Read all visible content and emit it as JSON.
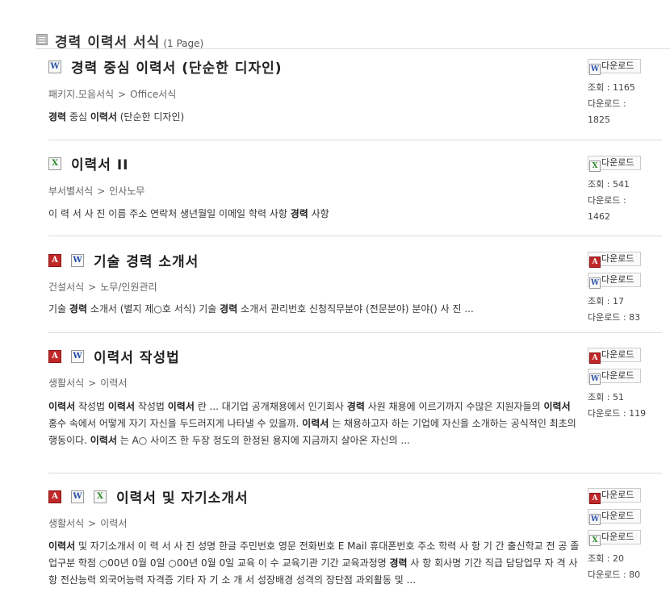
{
  "header": {
    "title": "경력 이력서 서식",
    "pages": "(1 Page)"
  },
  "download_label": "다운로드",
  "items": [
    {
      "title": "경력 중심 이력서 (단순한 디자인)",
      "cat1": "패키지.모음서식",
      "cat2": "Office서식",
      "desc_parts": [
        [
          "경력",
          true
        ],
        [
          " 중심 ",
          false
        ],
        [
          "이력서",
          true
        ],
        [
          " (단순한 디자인)",
          false
        ]
      ],
      "views_label": "조회 : 1165",
      "downloads_label": "다운로드 :",
      "downloads_value": "1825"
    },
    {
      "title": "이력서 II",
      "cat1": "부서별서식",
      "cat2": "인사노무",
      "desc_parts": [
        [
          "이 력 서 사 진 이름 주소 연락처 생년월일 이메일 학력 사항 ",
          false
        ],
        [
          "경력",
          true
        ],
        [
          " 사항",
          false
        ]
      ],
      "views_label": "조회 : 541",
      "downloads_label": "다운로드 :",
      "downloads_value": "1462"
    },
    {
      "title": "기술 경력 소개서",
      "cat1": "건설서식",
      "cat2": "노무/인원관리",
      "desc_parts": [
        [
          "기술 ",
          false
        ],
        [
          "경력",
          true
        ],
        [
          " 소개서 (별지 제○호 서식) 기술 ",
          false
        ],
        [
          "경력",
          true
        ],
        [
          " 소개서 관리번호 신청직무분야 (전문분야) 분야() 사 진 ...",
          false
        ]
      ],
      "views_label": "조회 : 17",
      "downloads_label": "다운로드 : 83"
    },
    {
      "title": "이력서 작성법",
      "cat1": "생활서식",
      "cat2": "이력서",
      "desc_parts": [
        [
          "이력서",
          true
        ],
        [
          " 작성법 ",
          false
        ],
        [
          "이력서",
          true
        ],
        [
          " 작성법 ",
          false
        ],
        [
          "이력서",
          true
        ],
        [
          " 란 ... 대기업 공개채용에서 인기회사 ",
          false
        ],
        [
          "경력",
          true
        ],
        [
          " 사원 채용에 이르기까지 수많은 지원자들의 ",
          false
        ],
        [
          "이력서",
          true
        ],
        [
          " 홍수 속에서 어떻게 자기 자신을 두드러지게 나타낼 수 있을까. ",
          false
        ],
        [
          "이력서",
          true
        ],
        [
          " 는 채용하고자 하는 기업에 자신을 소개하는 공식적인 최초의 행동이다. ",
          false
        ],
        [
          "이력서",
          true
        ],
        [
          " 는 A○ 사이즈 한 두장 정도의 한정된 용지에 지금까지 살아온 자신의 ...",
          false
        ]
      ],
      "views_label": "조회 : 51",
      "downloads_label": "다운로드 : 119"
    },
    {
      "title": "이력서 및 자기소개서",
      "cat1": "생활서식",
      "cat2": "이력서",
      "desc_parts": [
        [
          "이력서",
          true
        ],
        [
          " 및 자기소개서 이 력 서 사 진 성명 한글 주민번호 영문 전화번호 E Mail 휴대폰번호 주소 학력 사 항 기 간 출신학교 전 공 졸업구분 학점 ○00년 0월 0일 ○00년 0월 0일 교육 이 수 교육기관 기간 교육과정명 ",
          false
        ],
        [
          "경력",
          true
        ],
        [
          " 사 항 회사명 기간 직급 담당업무 자 격 사 항 전산능력 외국어능력 자격증 기타 자 기 소 개 서 성장배경 성격의 장단점 과외활동 및 ...",
          false
        ]
      ],
      "views_label": "조회 : 20",
      "downloads_label": "다운로드 : 80"
    }
  ]
}
